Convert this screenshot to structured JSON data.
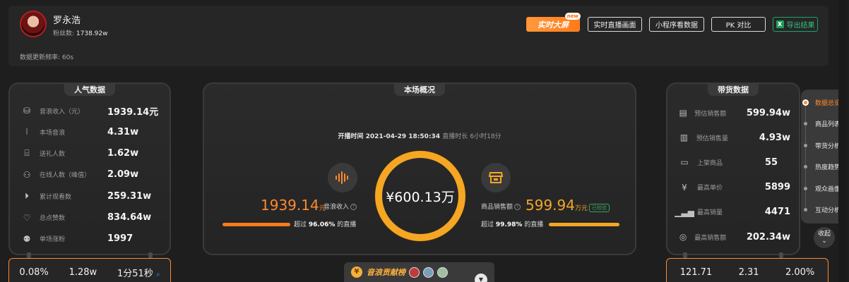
{
  "profile": {
    "name": "罗永浩",
    "fans_label": "粉丝数:",
    "fans_value": "1738.92w",
    "refresh_label": "数据更新频率:",
    "refresh_value": "60s"
  },
  "header_buttons": {
    "big_screen": "实时大屏",
    "new_badge": "new",
    "live_view": "实时直播画面",
    "mini_program": "小程序看数据",
    "pk": "PK 对比",
    "export": "导出结果"
  },
  "popularity": {
    "title": "人气数据",
    "rows": [
      {
        "icon": "coins-icon",
        "label": "音浪收入（元）",
        "value": "1939.14元"
      },
      {
        "icon": "wave-icon",
        "label": "本场音浪",
        "value": "4.31w"
      },
      {
        "icon": "gift-icon",
        "label": "送礼人数",
        "value": "1.62w"
      },
      {
        "icon": "user-icon",
        "label": "在线人数（峰值）",
        "value": "2.09w"
      },
      {
        "icon": "play-icon",
        "label": "累计观看数",
        "value": "259.31w"
      },
      {
        "icon": "heart-icon",
        "label": "总点赞数",
        "value": "834.64w"
      },
      {
        "icon": "follower-icon",
        "label": "单场涨粉",
        "value": "1997"
      }
    ]
  },
  "overview": {
    "title": "本场概况",
    "start_label": "开播时间",
    "start_value": "2021-04-29 18:50:34",
    "duration_label": "直播时长",
    "duration_value": "6小时18分",
    "total": "¥600.13万",
    "left": {
      "num": "1939.14",
      "unit": "元",
      "caption": "音浪收入",
      "beat_prefix": "超过",
      "beat_value": "96.06%",
      "beat_suffix": "的直播",
      "progress": 0.9606
    },
    "right": {
      "caption": "商品销售额",
      "num": "599.94",
      "unit": "万元",
      "verified": "已校验",
      "beat_prefix": "超过",
      "beat_value": "99.98%",
      "beat_suffix": "的直播",
      "progress": 0.9998
    }
  },
  "sales": {
    "title": "带货数据",
    "rows": [
      {
        "icon": "sales-icon",
        "label": "预估销售额",
        "value": "599.94w"
      },
      {
        "icon": "bar-chart-icon",
        "label": "预估销售量",
        "value": "4.93w"
      },
      {
        "icon": "shop-icon",
        "label": "上架商品",
        "value": "55"
      },
      {
        "icon": "yen-icon",
        "label": "最高单价",
        "value": "5899"
      },
      {
        "icon": "volume-icon",
        "label": "最高销量",
        "value": "4471"
      },
      {
        "icon": "money-icon",
        "label": "最高销售额",
        "value": "202.34w"
      }
    ]
  },
  "rank": {
    "title": "音浪贡献榜"
  },
  "bottom_left": [
    "0.08%",
    "1.28w",
    "1分51秒"
  ],
  "bottom_right": [
    "121.71",
    "2.31",
    "2.00%"
  ],
  "sidenav": {
    "items": [
      "数据总览",
      "商品列表",
      "带货分析",
      "热度趋势",
      "观众画像",
      "互动分析"
    ],
    "active": 0,
    "collapse": "收起"
  },
  "colors": {
    "accent": "#ff8a2a",
    "ring": "#f5a623",
    "success": "#3aa35a"
  }
}
